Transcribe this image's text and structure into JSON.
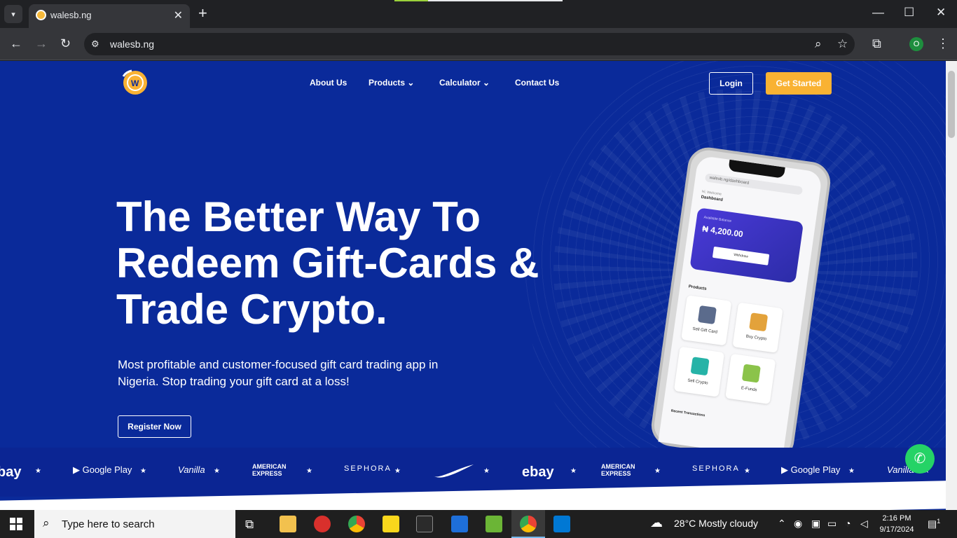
{
  "browser": {
    "tab_title": "walesb.ng",
    "tab_close": "✕",
    "new_tab": "+",
    "url": "walesb.ng",
    "window_controls": [
      "—",
      "☐",
      "✕"
    ],
    "profile_initial": "O"
  },
  "site": {
    "nav": [
      "About Us",
      "Products",
      "Calculator",
      "Contact Us"
    ],
    "login_label": "Login",
    "get_started_label": "Get Started",
    "hero_title_lines": [
      "The Better Way To",
      "Redeem Gift-Cards &",
      "Trade Crypto."
    ],
    "hero_subtitle": "Most profitable and customer-focused gift card trading app in Nigeria. Stop trading your gift card at a loss!",
    "register_label": "Register Now",
    "accent_color": "#f9b233",
    "background_color": "#0a2a9a"
  },
  "phone": {
    "url_text": "walesb.ng/dashboard",
    "greeting": "Hi, Welcome",
    "dashboard_label": "Dashboard",
    "balance_label": "Available Balance",
    "balance": "₦ 4,200.00",
    "withdraw_label": "Withdraw",
    "products_label": "Products",
    "tiles": [
      "Sell Gift Card",
      "Buy Crypto",
      "Sell Crypto",
      "E-Funds"
    ],
    "recent_label": "Recent Transactions"
  },
  "brands": [
    "bay",
    "★",
    "Google Play",
    "★",
    "Vanilla",
    "★",
    "AMERICAN EXPRESS",
    "★",
    "SEPHORA",
    "★",
    "Nike",
    "★",
    "ebay",
    "★",
    "AMERICAN EXPRESS",
    "★",
    "SEPHORA",
    "★",
    "Google Play",
    "★",
    "Vanilla",
    "★"
  ],
  "taskbar": {
    "search_placeholder": "Type here to search",
    "weather": "28°C  Mostly cloudy",
    "time": "2:16 PM",
    "date": "9/17/2024",
    "notification_count": "1"
  }
}
